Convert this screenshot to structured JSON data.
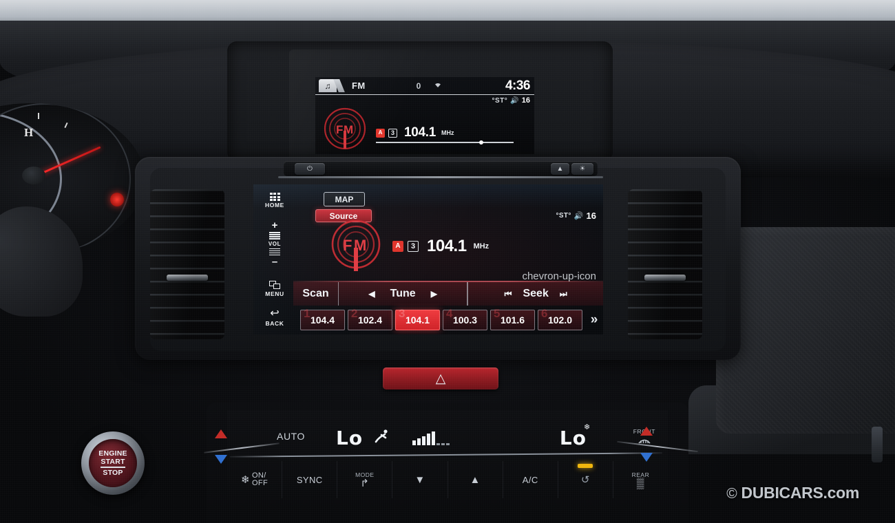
{
  "scene": {
    "title": "Honda Accord dashboard — FM radio on infotainment screen",
    "watermark_symbol": "©",
    "watermark_text": "DUBICARS.com"
  },
  "colors": {
    "accent_red": "#e0332a",
    "preset_active": "#ef3b3f",
    "dash_dark": "#0c0d10",
    "screen_text": "#ffffff",
    "led_amber": "#f0b60c",
    "temp_up": "#c32b26",
    "temp_down": "#2f6fd0"
  },
  "gauge_cluster": {
    "temp_label": "H"
  },
  "upper_display": {
    "tab_icon": "music-note-icon",
    "source_label": "FM",
    "counter": "0",
    "wifi_icon": "wifi-icon",
    "clock": "4:36",
    "stereo_label": "°ST°",
    "speaker_icon": "speaker-icon",
    "volume": "16",
    "station_logo": "FM",
    "badge_rds": "A",
    "badge_preset": "3",
    "frequency": "104.1",
    "unit": "MHz"
  },
  "head_unit": {
    "power_icon": "power-icon",
    "eject_icon": "eject-icon",
    "brightness_icon": "brightness-icon",
    "rail": [
      {
        "name": "home",
        "label": "HOME",
        "icon": "grid-icon"
      },
      {
        "name": "volume",
        "label": "VOL",
        "plus": "+",
        "minus": "–",
        "icon": "volume-bars-icon"
      },
      {
        "name": "menu",
        "label": "MENU",
        "icon": "windows-stack-icon"
      },
      {
        "name": "back",
        "label": "BACK",
        "icon": "back-arrow-icon"
      }
    ],
    "screen": {
      "map_button": "MAP",
      "source_button": "Source",
      "stereo_label": "°ST°",
      "speaker_icon": "speaker-icon",
      "volume": "16",
      "station_logo": "FM",
      "badge_rds": "A",
      "badge_preset": "3",
      "frequency": "104.1",
      "unit": "MHz",
      "expand_icon": "chevron-up-icon",
      "controls": {
        "scan": "Scan",
        "tune": "Tune",
        "tune_prev_icon": "◀",
        "tune_next_icon": "▶",
        "seek": "Seek",
        "seek_prev_icon": "⏮",
        "seek_next_icon": "⏭"
      },
      "presets": [
        {
          "num": "1",
          "freq": "104.4",
          "active": false
        },
        {
          "num": "2",
          "freq": "102.4",
          "active": false
        },
        {
          "num": "3",
          "freq": "104.1",
          "active": true
        },
        {
          "num": "4",
          "freq": "100.3",
          "active": false
        },
        {
          "num": "5",
          "freq": "101.6",
          "active": false
        },
        {
          "num": "6",
          "freq": "102.0",
          "active": false
        }
      ],
      "presets_next_icon": "»"
    }
  },
  "hazard": {
    "icon": "hazard-triangle-icon"
  },
  "climate": {
    "auto_label": "AUTO",
    "temp_left": "Lo",
    "temp_right": "Lo",
    "mode_icon": "airflow-person-icon",
    "snowflake_icon": "snowflake-icon",
    "fan_level_bars": 5,
    "fan_total_bars": 8,
    "front_defrost": {
      "label": "FRONT",
      "icon": "front-defrost-icon"
    },
    "buttons": [
      {
        "name": "fan-on-off",
        "line1": "ON/",
        "line2": "OFF",
        "icon": "fan-icon"
      },
      {
        "name": "sync",
        "label": "SYNC"
      },
      {
        "name": "mode",
        "label": "MODE",
        "icon": "mode-airflow-icon"
      },
      {
        "name": "fan-down",
        "icon": "fan-down-icon"
      },
      {
        "name": "fan-up",
        "icon": "fan-up-icon"
      },
      {
        "name": "ac",
        "label": "A/C"
      },
      {
        "name": "recirculation",
        "icon": "recirculate-car-icon",
        "led_on": true
      },
      {
        "name": "rear-defrost",
        "label": "REAR",
        "icon": "rear-defrost-icon"
      }
    ]
  },
  "engine_button": {
    "line1": "ENGINE",
    "line2": "START",
    "line3": "STOP"
  }
}
